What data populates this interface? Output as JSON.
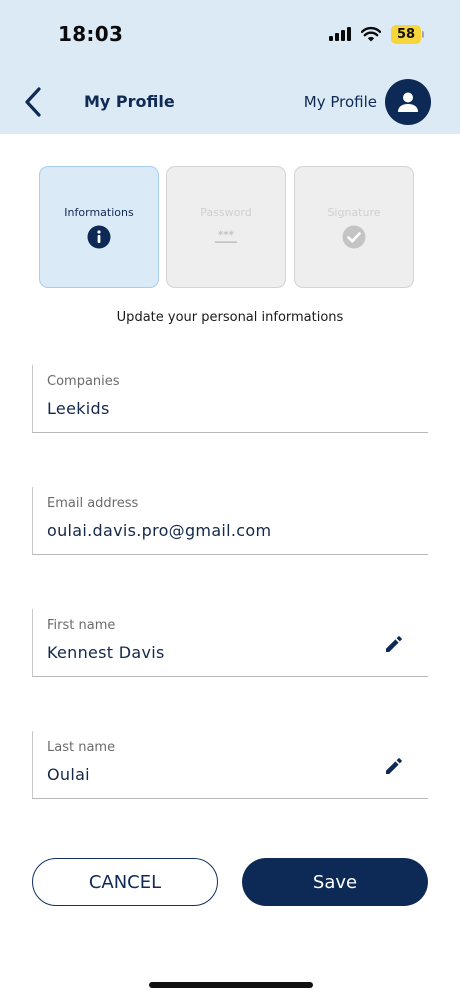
{
  "status_bar": {
    "time": "18:03",
    "battery": "58"
  },
  "header": {
    "title": "My Profile",
    "user_label": "My Profile"
  },
  "steps": [
    {
      "label": "Informations",
      "icon": "info-icon",
      "active": true
    },
    {
      "label": "Password",
      "icon": "password-dots-icon",
      "active": false
    },
    {
      "label": "Signature",
      "icon": "check-circle-icon",
      "active": false
    }
  ],
  "subtitle": "Update your personal informations",
  "fields": [
    {
      "label": "Companies",
      "value": "Leekids",
      "editable": false
    },
    {
      "label": "Email address",
      "value": "oulai.davis.pro@gmail.com",
      "editable": false
    },
    {
      "label": "First name",
      "value": "Kennest Davis",
      "editable": true
    },
    {
      "label": "Last name",
      "value": "Oulai",
      "editable": true
    }
  ],
  "buttons": {
    "cancel": "CANCEL",
    "save": "Save"
  },
  "colors": {
    "primary": "#0d2a57",
    "header_bg": "#dbeaf5",
    "active_step_bg": "#dbeaf7",
    "battery": "#f7d53c"
  }
}
